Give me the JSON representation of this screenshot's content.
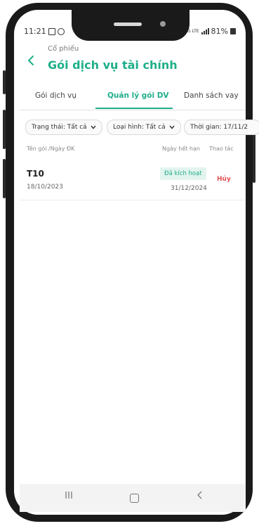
{
  "status_bar": {
    "time": "11:21",
    "battery": "81%",
    "network": "4G LTE"
  },
  "header": {
    "breadcrumb": "Cổ phiếu",
    "title": "Gói dịch vụ tài chính"
  },
  "tabs": [
    {
      "label": "Gói dịch vụ",
      "active": false
    },
    {
      "label": "Quản lý gói DV",
      "active": true
    },
    {
      "label": "Danh sách vay",
      "active": false
    }
  ],
  "filters": [
    {
      "label": "Trạng thái: Tất cả"
    },
    {
      "label": "Loại hình: Tất cả"
    },
    {
      "label": "Thời gian: 17/11/2"
    }
  ],
  "columns": {
    "name_date": "Tên gói /Ngày ĐK",
    "expiry": "Ngày hết hạn",
    "action": "Thao tác"
  },
  "rows": [
    {
      "name": "T10",
      "reg_date": "18/10/2023",
      "status": "Đã kích hoạt",
      "expiry": "31/12/2024",
      "action": "Hủy"
    }
  ],
  "colors": {
    "accent": "#1fae8a",
    "danger": "#e05050",
    "badge_bg": "#e3f4ee"
  },
  "icons": {
    "back": "chevron-left-icon",
    "filter_chevron": "chevron-down-icon"
  }
}
